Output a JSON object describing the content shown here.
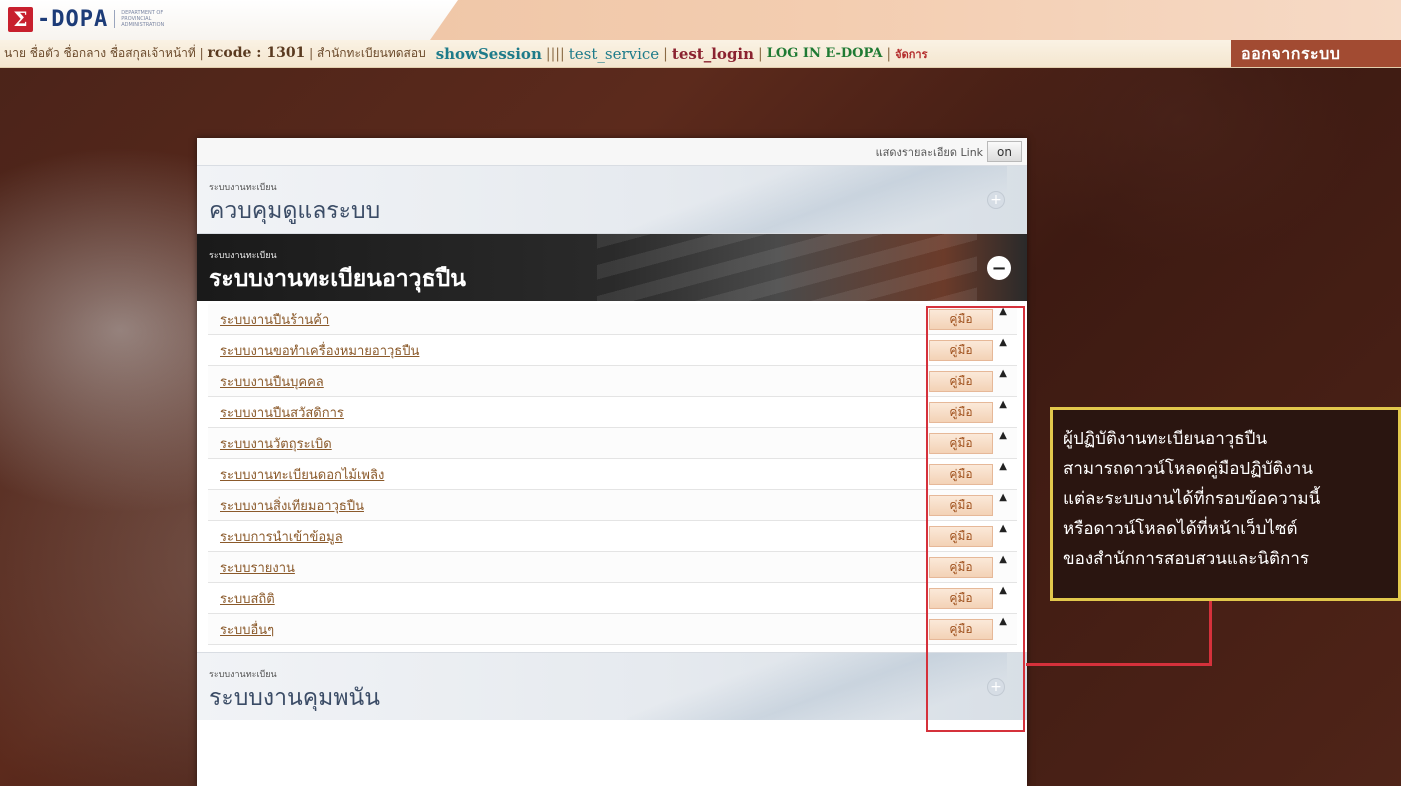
{
  "header": {
    "logo_mark": "Σ",
    "logo_word": "-DOPA",
    "logo_sub": "DEPARTMENT OF PROVINCIAL ADMINISTRATION",
    "user_name": "นาย ชื่อตัว ชื่อกลาง ชื่อสกุลเจ้าหน้าที่",
    "rcode": "rcode : 1301",
    "office": "สำนักทะเบียนทดสอบ",
    "nav": {
      "show_session": "showSession",
      "sep_multi": "||||",
      "test_service": "test_service",
      "test_login": "test_login",
      "login_edopa": "LOG IN E-DOPA",
      "manage": "จัดการ"
    },
    "logout": "ออกจากระบบ"
  },
  "panel": {
    "detail_label": "แสดงรายละเอียด Link",
    "toggle_label": "on",
    "sections": [
      {
        "small": "ระบบงานทะเบียน",
        "title": "ควบคุมดูแลระบบ",
        "toggle": "+"
      },
      {
        "small": "ระบบงานทะเบียน",
        "title": "ระบบงานทะเบียนอาวุธปืน",
        "toggle": "−"
      },
      {
        "small": "ระบบงานทะเบียน",
        "title": "ระบบงานคุมพนัน",
        "toggle": "+"
      }
    ],
    "manual_label": "คู่มือ",
    "items": [
      "ระบบงานปืนร้านค้า",
      "ระบบงานขอทำเครื่องหมายอาวุธปืน",
      "ระบบงานปืนบุคคล",
      "ระบบงานปืนสวัสดิการ",
      "ระบบงานวัตถุระเบิด",
      "ระบบงานทะเบียนดอกไม้เพลิง",
      "ระบบงานสิ่งเทียมอาวุธปืน",
      "ระบบการนำเข้าข้อมูล",
      "ระบบรายงาน",
      "ระบบสถิติ",
      "ระบบอื่นๆ"
    ]
  },
  "callout": {
    "lines": [
      "ผู้ปฏิบัติงานทะเบียนอาวุธปืน",
      "สามารถดาวน์โหลดคู่มือปฏิบัติงาน",
      "แต่ละระบบงานได้ที่กรอบข้อความนี้",
      "หรือดาวน์โหลดได้ที่หน้าเว็บไซต์",
      "ของสำนักการสอบสวนและนิติการ"
    ],
    "colors": {
      "border": "#e2c84c",
      "highlight": "#d5313b"
    }
  }
}
